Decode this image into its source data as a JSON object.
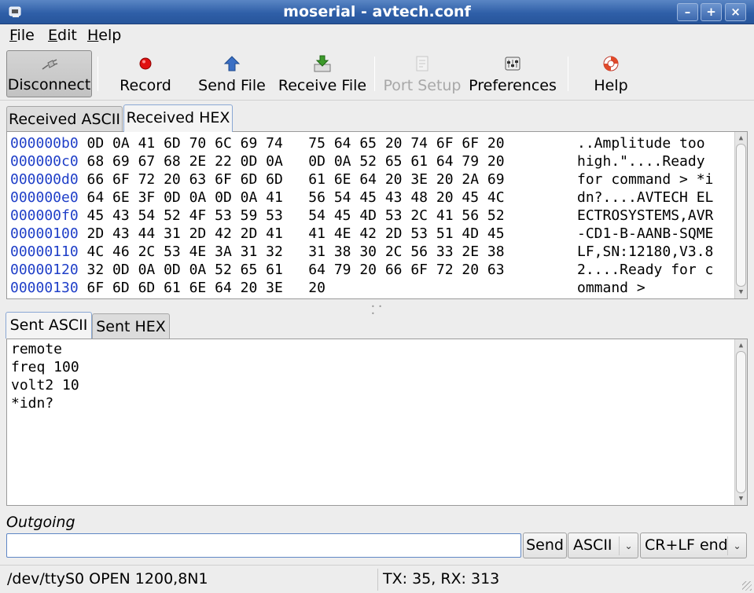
{
  "window": {
    "title": "moserial - avtech.conf",
    "controls": {
      "minimize": "–",
      "maximize": "+",
      "close": "×"
    }
  },
  "menu": [
    {
      "label": "File",
      "accel": "F",
      "rest": "ile"
    },
    {
      "label": "Edit",
      "accel": "E",
      "rest": "dit"
    },
    {
      "label": "Help",
      "accel": "H",
      "rest": "elp"
    }
  ],
  "toolbar": {
    "disconnect": {
      "label": "Disconnect",
      "icon": "plug-icon"
    },
    "record": {
      "label": "Record",
      "icon": "record-icon",
      "color": "#e01010"
    },
    "send_file": {
      "label": "Send File",
      "icon": "arrow-up-icon",
      "color": "#3a6fc4"
    },
    "receive_file": {
      "label": "Receive File",
      "icon": "download-icon",
      "color": "#3c9a2a"
    },
    "port_setup": {
      "label": "Port Setup",
      "icon": "port-setup-icon",
      "disabled": true
    },
    "preferences": {
      "label": "Preferences",
      "icon": "preferences-icon"
    },
    "help": {
      "label": "Help",
      "icon": "lifebuoy-icon"
    }
  },
  "received": {
    "tabs": [
      {
        "label": "Received ASCII",
        "active": false
      },
      {
        "label": "Received HEX",
        "active": true
      }
    ],
    "hex_rows": [
      {
        "addr": "000000b0",
        "bytes": "0D 0A 41 6D 70 6C 69 74   75 64 65 20 74 6F 6F 20",
        "ascii": "..Amplitude too "
      },
      {
        "addr": "000000c0",
        "bytes": "68 69 67 68 2E 22 0D 0A   0D 0A 52 65 61 64 79 20",
        "ascii": "high.\"....Ready "
      },
      {
        "addr": "000000d0",
        "bytes": "66 6F 72 20 63 6F 6D 6D   61 6E 64 20 3E 20 2A 69",
        "ascii": "for command > *i"
      },
      {
        "addr": "000000e0",
        "bytes": "64 6E 3F 0D 0A 0D 0A 41   56 54 45 43 48 20 45 4C",
        "ascii": "dn?....AVTECH EL"
      },
      {
        "addr": "000000f0",
        "bytes": "45 43 54 52 4F 53 59 53   54 45 4D 53 2C 41 56 52",
        "ascii": "ECTROSYSTEMS,AVR"
      },
      {
        "addr": "00000100",
        "bytes": "2D 43 44 31 2D 42 2D 41   41 4E 42 2D 53 51 4D 45",
        "ascii": "-CD1-B-AANB-SQME"
      },
      {
        "addr": "00000110",
        "bytes": "4C 46 2C 53 4E 3A 31 32   31 38 30 2C 56 33 2E 38",
        "ascii": "LF,SN:12180,V3.8"
      },
      {
        "addr": "00000120",
        "bytes": "32 0D 0A 0D 0A 52 65 61   64 79 20 66 6F 72 20 63",
        "ascii": "2....Ready for c"
      },
      {
        "addr": "00000130",
        "bytes": "6F 6D 6D 61 6E 64 20 3E   20",
        "ascii": "ommand > "
      }
    ]
  },
  "sent": {
    "tabs": [
      {
        "label": "Sent ASCII",
        "active": true
      },
      {
        "label": "Sent HEX",
        "active": false
      }
    ],
    "lines": [
      "remote",
      "freq 100",
      "volt2 10",
      "*idn?"
    ]
  },
  "outgoing": {
    "label": "Outgoing",
    "value": "",
    "send_label": "Send",
    "format": "ASCII",
    "line_end": "CR+LF end"
  },
  "status": {
    "port": "/dev/ttyS0 OPEN 1200,8N1",
    "counts": "TX: 35, RX: 313"
  }
}
